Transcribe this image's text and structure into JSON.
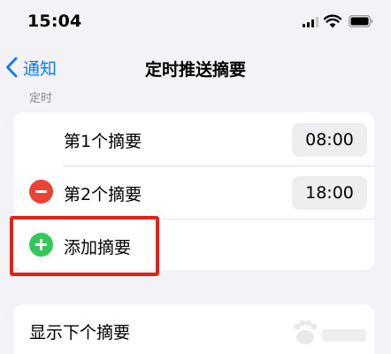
{
  "status_bar": {
    "time": "15:04",
    "icons": [
      "cellular-signal-icon",
      "wifi-icon",
      "battery-icon"
    ]
  },
  "nav": {
    "back_label": "通知",
    "title": "定时推送摘要"
  },
  "section": {
    "header": "定时"
  },
  "schedule": {
    "items": [
      {
        "label": "第1个摘要",
        "time": "08:00"
      },
      {
        "label": "第2个摘要",
        "time": "18:00",
        "icon": "remove-circle-icon"
      }
    ],
    "add_label": "添加摘要",
    "add_icon": "add-circle-icon"
  },
  "next_section": {
    "label": "显示下个摘要"
  },
  "colors": {
    "accent": "#0a7aff",
    "delete": "#ea4335",
    "add": "#34c759",
    "highlight": "#e0231a",
    "background": "#f2f2f7"
  }
}
